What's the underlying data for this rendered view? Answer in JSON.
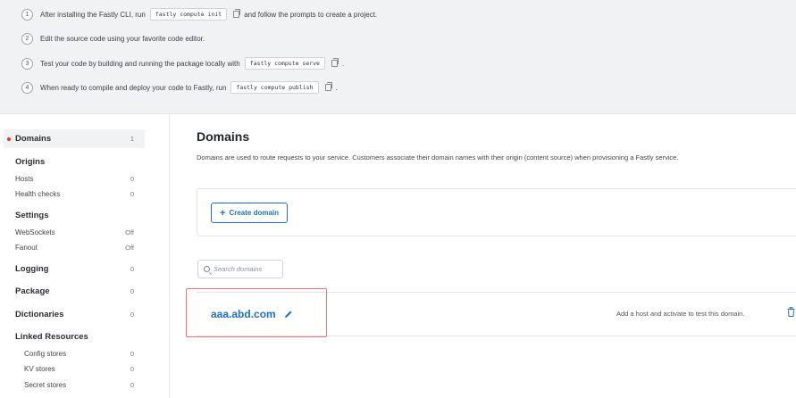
{
  "steps": [
    {
      "num": "1",
      "before": "After installing the Fastly CLI, run",
      "code": "fastly compute init",
      "after": "and follow the prompts to create a project."
    },
    {
      "num": "2",
      "before": "Edit the source code using your favorite code editor.",
      "code": "",
      "after": ""
    },
    {
      "num": "3",
      "before": "Test your code by building and running the package locally with",
      "code": "fastly compute serve",
      "after": "."
    },
    {
      "num": "4",
      "before": "When ready to compile and deploy your code to Fastly, run",
      "code": "fastly compute publish",
      "after": "."
    }
  ],
  "sidebar": {
    "domains": {
      "label": "Domains",
      "count": "1"
    },
    "origins": {
      "label": "Origins",
      "items": [
        {
          "label": "Hosts",
          "value": "0"
        },
        {
          "label": "Health checks",
          "value": "0"
        }
      ]
    },
    "settings": {
      "label": "Settings",
      "items": [
        {
          "label": "WebSockets",
          "value": "Off"
        },
        {
          "label": "Fanout",
          "value": "Off"
        }
      ]
    },
    "logging": {
      "label": "Logging",
      "count": "0"
    },
    "package": {
      "label": "Package",
      "count": "0"
    },
    "dictionaries": {
      "label": "Dictionaries",
      "count": "0"
    },
    "linked": {
      "label": "Linked Resources",
      "items": [
        {
          "label": "Config stores",
          "value": "0"
        },
        {
          "label": "KV stores",
          "value": "0"
        },
        {
          "label": "Secret stores",
          "value": "0"
        }
      ]
    }
  },
  "main": {
    "title": "Domains",
    "description": "Domains are used to route requests to your service. Customers associate their domain names with their origin (content source) when provisioning a Fastly service.",
    "create_label": "Create domain",
    "search_placeholder": "Search domains",
    "domain": {
      "name": "aaa.abd.com",
      "hint": "Add a host and activate to test this domain."
    }
  },
  "colors": {
    "accent": "#1f6fbf",
    "active_dot": "#e8312f",
    "highlight": "#e9786b"
  }
}
